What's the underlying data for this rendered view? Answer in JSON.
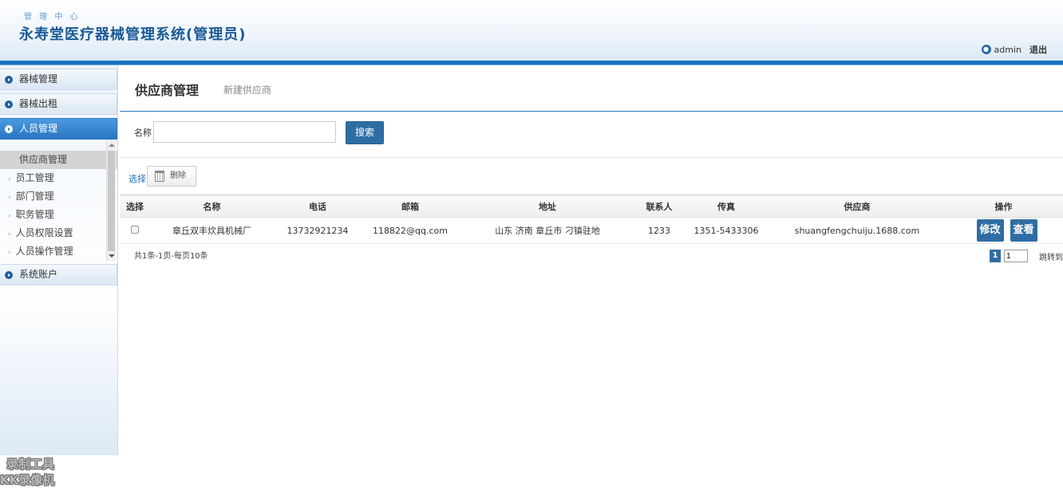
{
  "header": {
    "sub": "管 理 中 心",
    "title": "永寿堂医疗器械管理系统(管理员)",
    "user": "admin",
    "logout": "退出"
  },
  "sidebar": {
    "menus": [
      {
        "label": "器械管理"
      },
      {
        "label": "器械出租"
      },
      {
        "label": "人员管理"
      },
      {
        "label": "系统账户"
      }
    ],
    "items": [
      {
        "label": "供应商管理"
      },
      {
        "label": "员工管理"
      },
      {
        "label": "部门管理"
      },
      {
        "label": "职务管理"
      },
      {
        "label": "人员权限设置"
      },
      {
        "label": "人员操作管理"
      }
    ]
  },
  "tabs": {
    "active": "供应商管理",
    "other": "新建供应商"
  },
  "search": {
    "label": "名称",
    "value": "",
    "button": "搜索"
  },
  "toolbar": {
    "select": "选择",
    "delete": "删除"
  },
  "table": {
    "headers": [
      "选择",
      "名称",
      "电话",
      "邮箱",
      "地址",
      "联系人",
      "传真",
      "供应商",
      "操作"
    ],
    "rows": [
      {
        "name": "章丘双丰炊具机械厂",
        "phone": "13732921234",
        "email": "118822@qq.com",
        "address": "山东 济南 章丘市 刁镇驻地",
        "contact": "1233",
        "fax": "1351-5433306",
        "supplier": "shuangfengchuiju.1688.com",
        "edit": "修改",
        "view": "查看"
      }
    ]
  },
  "footer": {
    "summary": "共1条-1页-每页10条",
    "page": "1",
    "page_input": "1",
    "jump": "跳转到"
  },
  "watermark": {
    "line1": "录制工具",
    "line2": "KK录像机"
  }
}
